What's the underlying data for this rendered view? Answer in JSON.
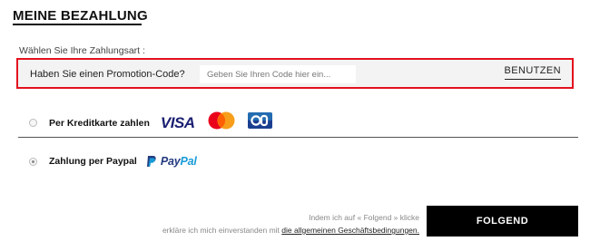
{
  "page": {
    "title": "MEINE BEZAHLUNG",
    "subtitle": "Wählen Sie Ihre Zahlungsart :"
  },
  "promo": {
    "label": "Haben Sie einen Promotion-Code?",
    "placeholder": "Geben Sie Ihren Code hier ein...",
    "value": "",
    "apply_label": "BENUTZEN",
    "border_color": "#e3101d"
  },
  "payment_options": [
    {
      "label": "Per Kreditkarte zahlen",
      "selected": false,
      "logos": [
        "visa-logo",
        "mastercard-logo",
        "cb-card-logo"
      ],
      "visa_text": "VISA"
    },
    {
      "label": "Zahlung per Paypal",
      "selected": true,
      "logos": [
        "paypal-logo"
      ],
      "paypal_text_1": "Pay",
      "paypal_text_2": "Pal"
    }
  ],
  "legal": {
    "line1": "Indem ich auf « Folgend » klicke",
    "line2_prefix": "erkläre ich mich einverstanden mit",
    "link": "die allgemeinen Geschäftsbedingungen."
  },
  "actions": {
    "next_label": "FOLGEND"
  },
  "colors": {
    "brand_visa": "#1a1f71",
    "paypal_dark": "#253b80",
    "paypal_light": "#179bd7",
    "button_bg": "#000000"
  }
}
